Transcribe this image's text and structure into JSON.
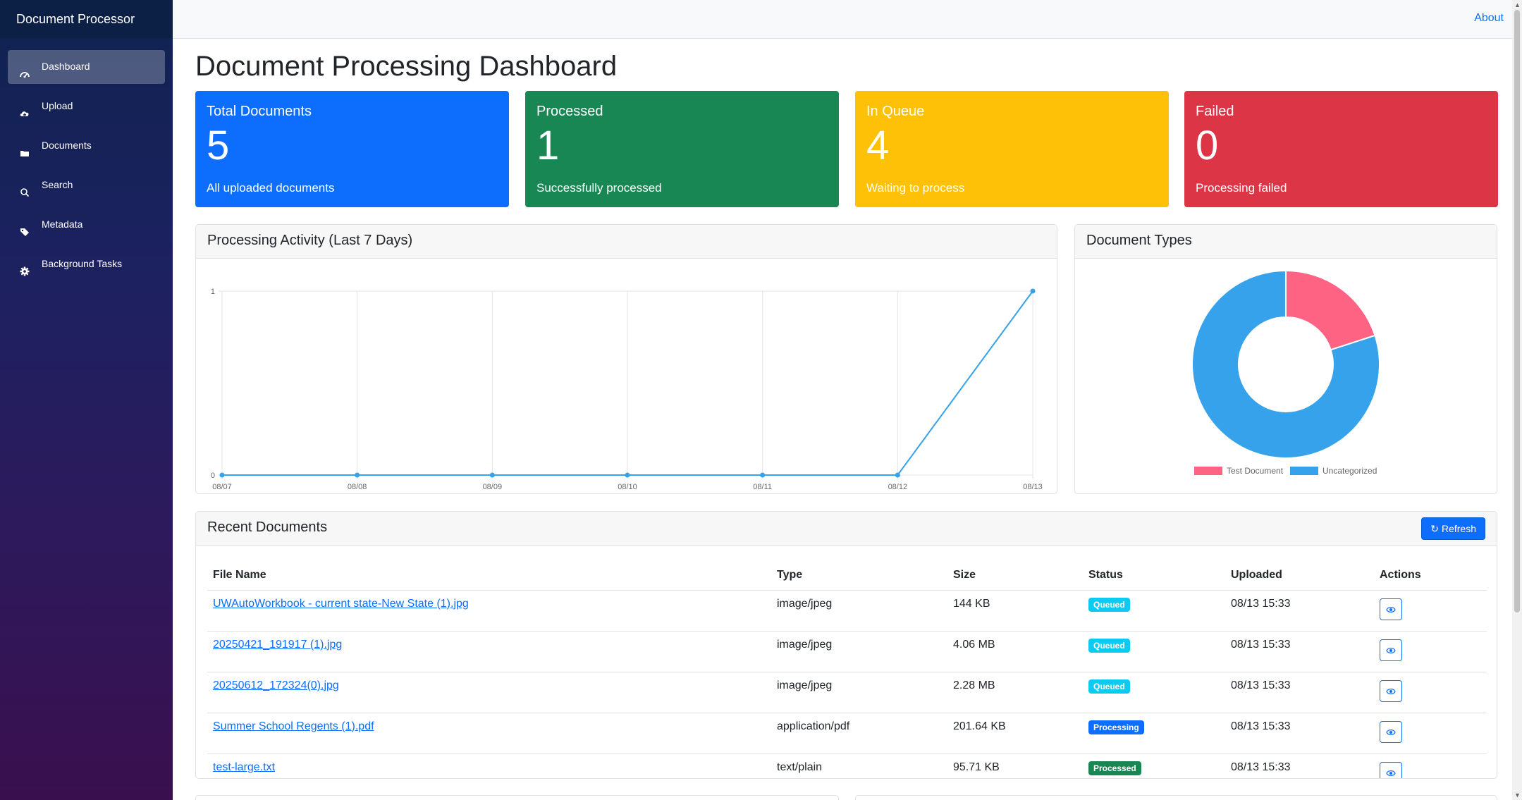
{
  "app": {
    "brand": "Document Processor",
    "about": "About"
  },
  "sidebar": {
    "items": [
      {
        "label": "Dashboard",
        "icon": "speedometer-icon",
        "active": true
      },
      {
        "label": "Upload",
        "icon": "cloud-upload-icon",
        "active": false
      },
      {
        "label": "Documents",
        "icon": "folder-icon",
        "active": false
      },
      {
        "label": "Search",
        "icon": "search-icon",
        "active": false
      },
      {
        "label": "Metadata",
        "icon": "tag-icon",
        "active": false
      },
      {
        "label": "Background Tasks",
        "icon": "gear-icon",
        "active": false
      }
    ]
  },
  "page": {
    "title": "Document Processing Dashboard"
  },
  "stats": [
    {
      "title": "Total Documents",
      "value": "5",
      "desc": "All uploaded documents",
      "color": "#0d6efd"
    },
    {
      "title": "Processed",
      "value": "1",
      "desc": "Successfully processed",
      "color": "#198754"
    },
    {
      "title": "In Queue",
      "value": "4",
      "desc": "Waiting to process",
      "color": "#ffc107"
    },
    {
      "title": "Failed",
      "value": "0",
      "desc": "Processing failed",
      "color": "#dc3545"
    }
  ],
  "activity": {
    "title": "Processing Activity (Last 7 Days)",
    "chart_data": {
      "type": "line",
      "categories": [
        "08/07",
        "08/08",
        "08/09",
        "08/10",
        "08/11",
        "08/12",
        "08/13"
      ],
      "values": [
        0,
        0,
        0,
        0,
        0,
        0,
        1
      ],
      "ylim": [
        0,
        1
      ],
      "yticks": [
        "0",
        "1"
      ],
      "color": "#36a2eb",
      "grid": true
    }
  },
  "types": {
    "title": "Document Types",
    "chart_data": {
      "type": "pie",
      "categories": [
        "Test Document",
        "Uncategorized"
      ],
      "values": [
        1,
        4
      ],
      "colors": [
        "#ff6384",
        "#36a2eb"
      ],
      "legend": "bottom"
    }
  },
  "recent": {
    "title": "Recent Documents",
    "refresh_label": "Refresh",
    "columns": [
      "File Name",
      "Type",
      "Size",
      "Status",
      "Uploaded",
      "Actions"
    ],
    "rows": [
      {
        "name": "UWAutoWorkbook - current state-New State (1).jpg",
        "type": "image/jpeg",
        "size": "144 KB",
        "status": "Queued",
        "uploaded": "08/13 15:33"
      },
      {
        "name": "20250421_191917 (1).jpg",
        "type": "image/jpeg",
        "size": "4.06 MB",
        "status": "Queued",
        "uploaded": "08/13 15:33"
      },
      {
        "name": "20250612_172324(0).jpg",
        "type": "image/jpeg",
        "size": "2.28 MB",
        "status": "Queued",
        "uploaded": "08/13 15:33"
      },
      {
        "name": "Summer School Regents (1).pdf",
        "type": "application/pdf",
        "size": "201.64 KB",
        "status": "Processing",
        "uploaded": "08/13 15:33"
      },
      {
        "name": "test-large.txt",
        "type": "text/plain",
        "size": "95.71 KB",
        "status": "Processed",
        "uploaded": "08/13 15:33"
      }
    ],
    "status_colors": {
      "Queued": "#0dcaf0",
      "Processing": "#0d6efd",
      "Processed": "#198754"
    }
  }
}
